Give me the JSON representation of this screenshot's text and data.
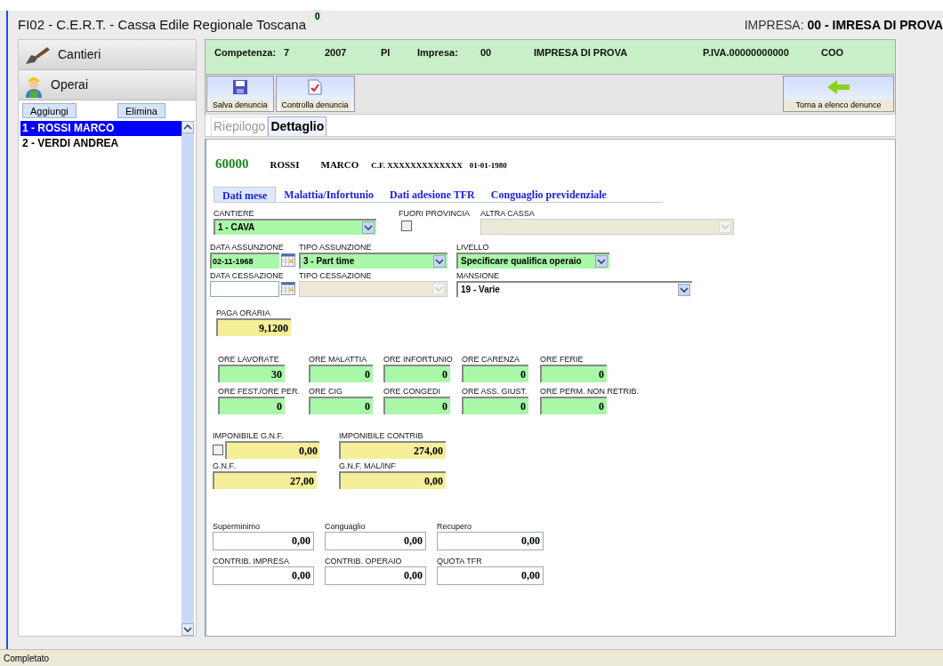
{
  "window": {
    "title": "FI02 - C.E.R.T. - Cassa Edile Regionale Toscana",
    "badge": "0",
    "impresa_label": "IMPRESA:",
    "impresa_value": "00 - IMRESA DI PROVA"
  },
  "sidebar": {
    "sections": [
      {
        "label": "Cantieri",
        "kind": "trowel"
      },
      {
        "label": "Operai",
        "kind": "worker"
      }
    ],
    "buttons": [
      "Aggiungi",
      "Elimina"
    ],
    "workers": [
      {
        "label": "1 - ROSSI MARCO",
        "selected": true
      },
      {
        "label": "2 - VERDI ANDREA",
        "selected": false
      }
    ]
  },
  "header_bar": [
    "Competenza:",
    "7",
    "2007",
    "PI",
    "Impresa:",
    "00",
    "IMPRESA DI PROVA",
    "P.IVA.00000000000",
    "COO"
  ],
  "toolbar": {
    "buttons": [
      {
        "label": "Salva denuncia",
        "kind": "save"
      },
      {
        "label": "Controlla denuncia",
        "kind": "check"
      }
    ],
    "back_button": "Torna a elenco denunce"
  },
  "view_tabs": [
    {
      "label": "Riepilogo",
      "selected": false
    },
    {
      "label": "Dettaglio",
      "selected": true
    }
  ],
  "worker": {
    "code": "60000",
    "surname": "ROSSI",
    "name": "MARCO",
    "cf": "C.F. XXXXXXXXXXXXX",
    "birth_date": "01-01-1980"
  },
  "section_tabs": [
    {
      "label": "Dati mese",
      "selected": true
    },
    {
      "label": "Malattia/Infortunio",
      "selected": false
    },
    {
      "label": "Dati adesione TFR",
      "selected": false
    },
    {
      "label": "Conguaglio previdenziale",
      "selected": false
    }
  ],
  "field_rows": [
    [
      {
        "label": "CANTIERE",
        "kind": "select",
        "value": "1 - CAVA",
        "color": "#a8f8a8",
        "disabled": false
      },
      {
        "label": "FUORI PROVINCIA",
        "kind": "checkbox",
        "checked": false
      },
      {
        "label": "ALTRA CASSA",
        "kind": "select",
        "color": "#ece9d8",
        "disabled": true
      }
    ],
    [
      {
        "label": "DATA ASSUNZIONE",
        "kind": "date",
        "value": "02-11-1968",
        "color": "#a8f8a8"
      },
      {
        "label": "TIPO ASSUNZIONE",
        "kind": "select",
        "value": "3 - Part time",
        "color": "#a8f8a8",
        "disabled": false
      },
      {
        "label": "LIVELLO",
        "kind": "select",
        "value": "Specificare qualifica operaio",
        "color": "#a8f8a8",
        "disabled": false
      }
    ],
    [
      {
        "label": "DATA CESSAZIONE",
        "kind": "date",
        "color": "#ffffff"
      },
      {
        "label": "TIPO CESSAZIONE",
        "kind": "select",
        "color": "#ece9d8",
        "disabled": true
      },
      {
        "label": "MANSIONE",
        "kind": "select",
        "value": "19 - Varie",
        "color": "#ffffff",
        "disabled": false
      }
    ],
    [
      {
        "label": "PAGA ORARIA",
        "kind": "number",
        "value": "9,1200",
        "color": "#f5ef9a"
      }
    ],
    [
      {
        "label": "ORE LAVORATE",
        "kind": "number",
        "value": "30",
        "color": "#a8f8a8"
      },
      {
        "label": "ORE MALATTIA",
        "kind": "number",
        "value": "0",
        "color": "#a8f8a8"
      },
      {
        "label": "ORE INFORTUNIO",
        "kind": "number",
        "value": "0",
        "color": "#a8f8a8"
      },
      {
        "label": "ORE CARENZA",
        "kind": "number",
        "value": "0",
        "color": "#a8f8a8"
      },
      {
        "label": "ORE FERIE",
        "kind": "number",
        "value": "0",
        "color": "#a8f8a8"
      }
    ],
    [
      {
        "label": "ORE FEST./ORE PER.",
        "kind": "number",
        "value": "0",
        "color": "#a8f8a8"
      },
      {
        "label": "ORE CIG",
        "kind": "number",
        "value": "0",
        "color": "#a8f8a8"
      },
      {
        "label": "ORE CONGEDI",
        "kind": "number",
        "value": "0",
        "color": "#a8f8a8"
      },
      {
        "label": "ORE ASS. GIUST.",
        "kind": "number",
        "value": "0",
        "color": "#a8f8a8"
      },
      {
        "label": "ORE PERM. NON RETRIB.",
        "kind": "number",
        "value": "0",
        "color": "#a8f8a8"
      }
    ],
    [
      {
        "label": "IMPONIBILE G.N.F.",
        "kind": "check_number",
        "checked": false,
        "value": "0,00",
        "color": "#f5ef9a"
      },
      {
        "label": "IMPONIBILE CONTRIB",
        "kind": "number",
        "value": "274,00",
        "color": "#f5ef9a"
      }
    ],
    [
      {
        "label": "G.N.F.",
        "kind": "number",
        "value": "27,00",
        "color": "#f5ef9a"
      },
      {
        "label": "G.N.F. MAL/INF",
        "kind": "number",
        "value": "0,00",
        "color": "#f5ef9a"
      }
    ],
    [
      {
        "label": "Superminimo",
        "kind": "number",
        "value": "0,00",
        "color": "#ffffff"
      },
      {
        "label": "Conguaglio",
        "kind": "number",
        "value": "0,00",
        "color": "#ffffff"
      },
      {
        "label": "Recupero",
        "kind": "number",
        "value": "0,00",
        "color": "#ffffff"
      }
    ],
    [
      {
        "label": "CONTRIB. IMPRESA",
        "kind": "number",
        "value": "0,00",
        "color": "#ffffff"
      },
      {
        "label": "CONTRIB. OPERAIO",
        "kind": "number",
        "value": "0,00",
        "color": "#ffffff"
      },
      {
        "label": "QUOTA TFR",
        "kind": "number",
        "value": "0,00",
        "color": "#ffffff"
      }
    ]
  ],
  "status_bar": "Completato"
}
